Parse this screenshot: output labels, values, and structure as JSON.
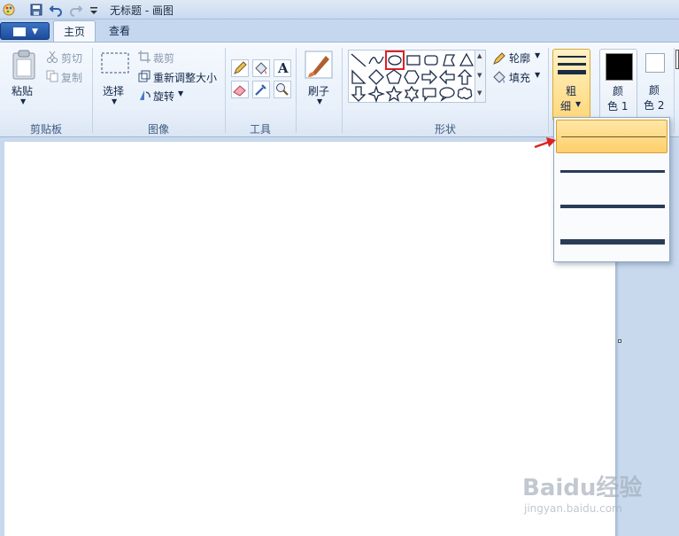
{
  "window": {
    "title": "无标题 - 画图"
  },
  "tabs": {
    "home": "主页",
    "view": "查看"
  },
  "clipboard": {
    "paste": "粘贴",
    "cut": "剪切",
    "copy": "复制",
    "label": "剪贴板"
  },
  "image": {
    "select": "选择",
    "crop": "裁剪",
    "resize": "重新调整大小",
    "rotate": "旋转",
    "label": "图像"
  },
  "tools": {
    "label": "工具",
    "text_tool_glyph": "A"
  },
  "brush": {
    "label": "刷子"
  },
  "shapes": {
    "outline": "轮廓",
    "fill": "填充",
    "label": "形状",
    "selected": "oval"
  },
  "size": {
    "label_line1": "粗",
    "label_line2": "细",
    "options": [
      "1px",
      "3px",
      "5px",
      "8px"
    ],
    "selected_index": 0
  },
  "colors": {
    "color1_line1": "颜",
    "color1_line2": "色 1",
    "color2_line1": "颜",
    "color2_line2": "色 2",
    "color1": "#000000",
    "color2": "#ffffff"
  },
  "watermark": {
    "brand": "Baidu经验",
    "url": "jingyan.baidu.com"
  },
  "accent": {
    "highlight": "#ffd77a",
    "arrow": "#e02020"
  }
}
